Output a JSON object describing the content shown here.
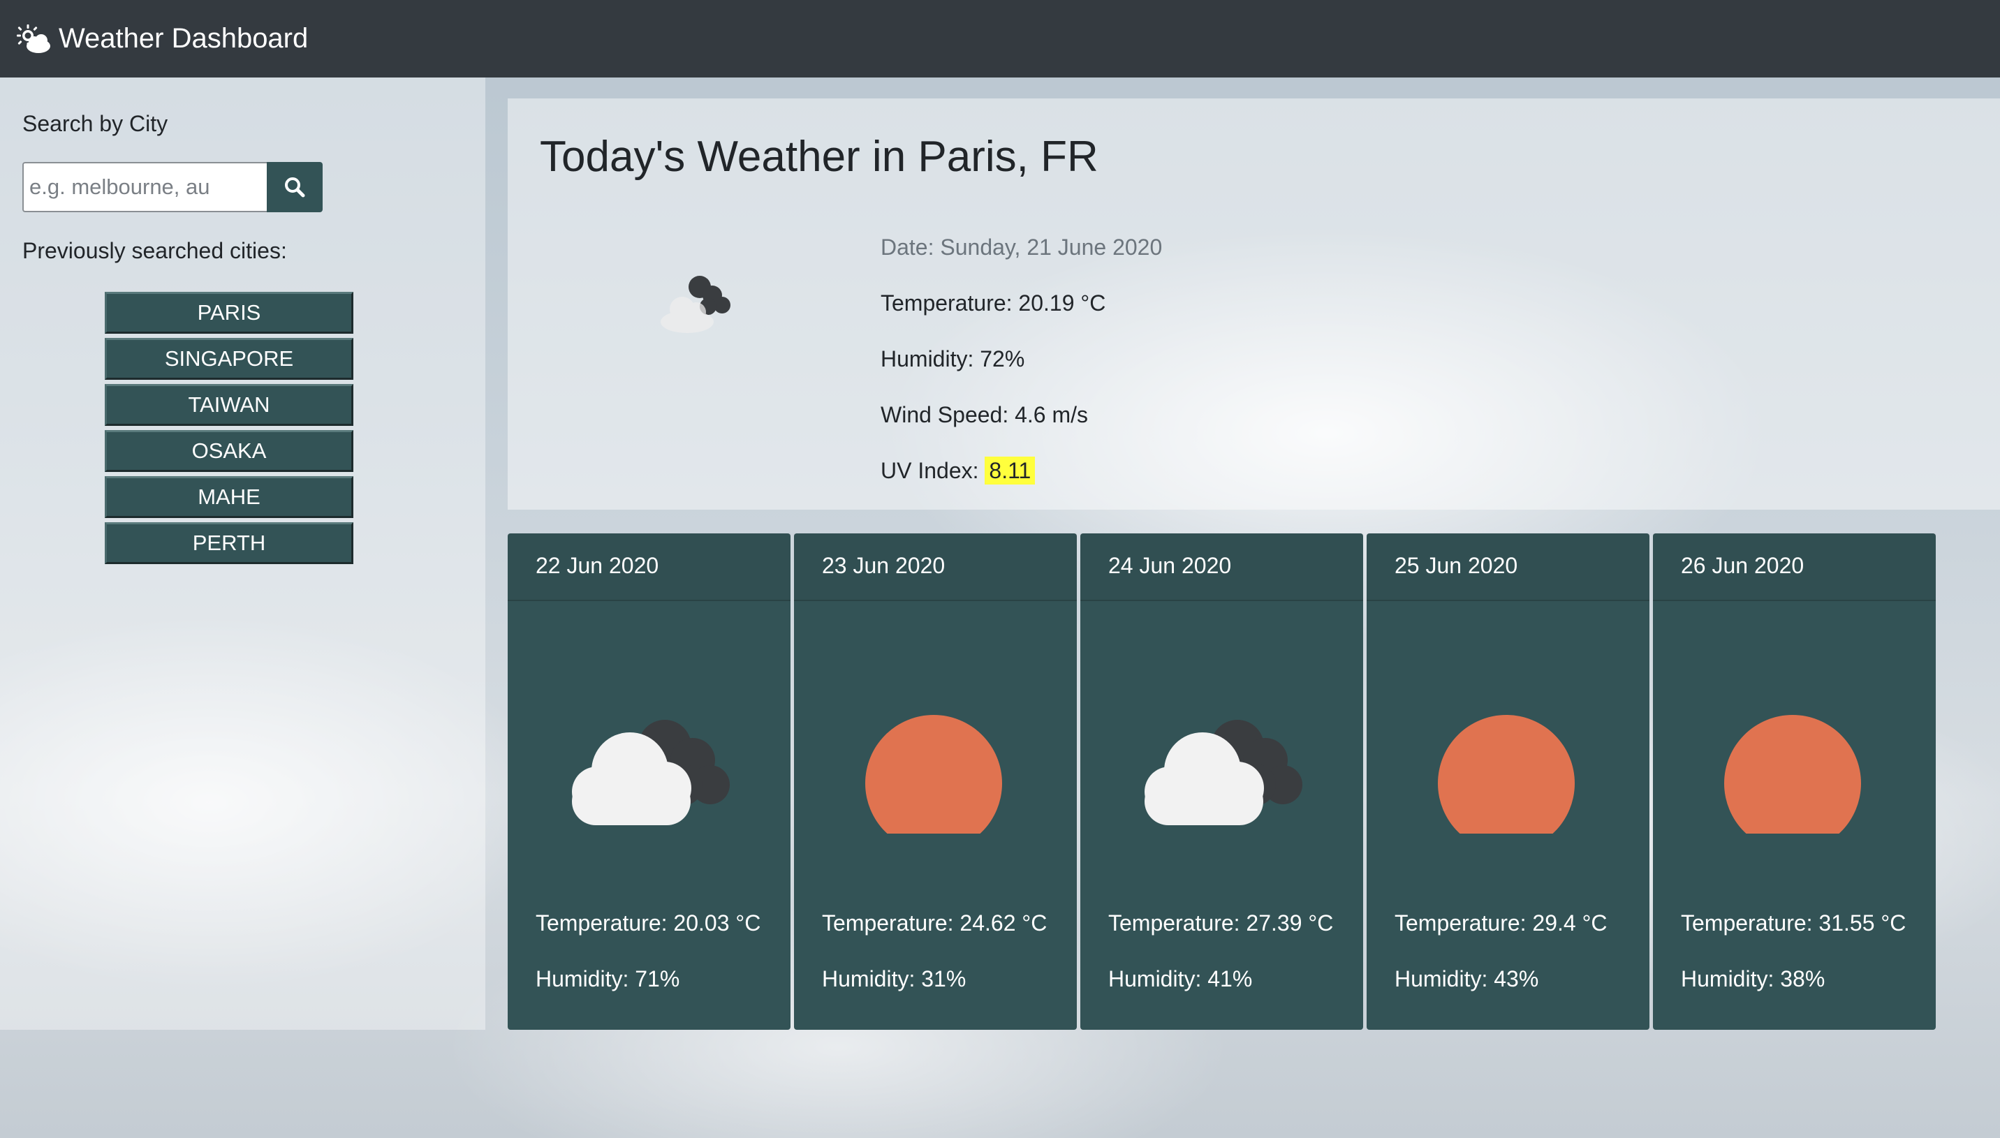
{
  "header": {
    "title": "Weather Dashboard",
    "icon": "cloud-sun-icon"
  },
  "sidebar": {
    "search_label": "Search by City",
    "search_placeholder": "e.g. melbourne, au",
    "search_value": "",
    "search_button_icon": "search-icon",
    "history_label": "Previously searched cities:",
    "history": [
      "Paris",
      "Singapore",
      "Taiwan",
      "Osaka",
      "Mahe",
      "Perth"
    ]
  },
  "current": {
    "title": "Today's Weather in Paris, FR",
    "icon": "broken-clouds-icon",
    "date": "Date: Sunday, 21 June 2020",
    "temperature": "Temperature: 20.19 °C",
    "humidity": "Humidity: 72%",
    "wind": "Wind Speed: 4.6 m/s",
    "uv_label": "UV Index:",
    "uv_value": "8.11",
    "uv_color": "#ffff3d"
  },
  "forecast": [
    {
      "date": "22 Jun 2020",
      "icon": "broken-clouds-icon",
      "temperature": "Temperature: 20.03 °C",
      "humidity": "Humidity: 71%"
    },
    {
      "date": "23 Jun 2020",
      "icon": "clear-sky-sun-icon",
      "temperature": "Temperature: 24.62 °C",
      "humidity": "Humidity: 31%"
    },
    {
      "date": "24 Jun 2020",
      "icon": "broken-clouds-icon",
      "temperature": "Temperature: 27.39 °C",
      "humidity": "Humidity: 41%"
    },
    {
      "date": "25 Jun 2020",
      "icon": "clear-sky-sun-icon",
      "temperature": "Temperature: 29.4 °C",
      "humidity": "Humidity: 43%"
    },
    {
      "date": "26 Jun 2020",
      "icon": "clear-sky-sun-icon",
      "temperature": "Temperature: 31.55 °C",
      "humidity": "Humidity: 38%"
    }
  ],
  "colors": {
    "navbar": "#343a40",
    "card": "#335356",
    "sun": "#e07350",
    "cloud": "#f2f2f2",
    "dark_cloud": "#3a3d40"
  }
}
